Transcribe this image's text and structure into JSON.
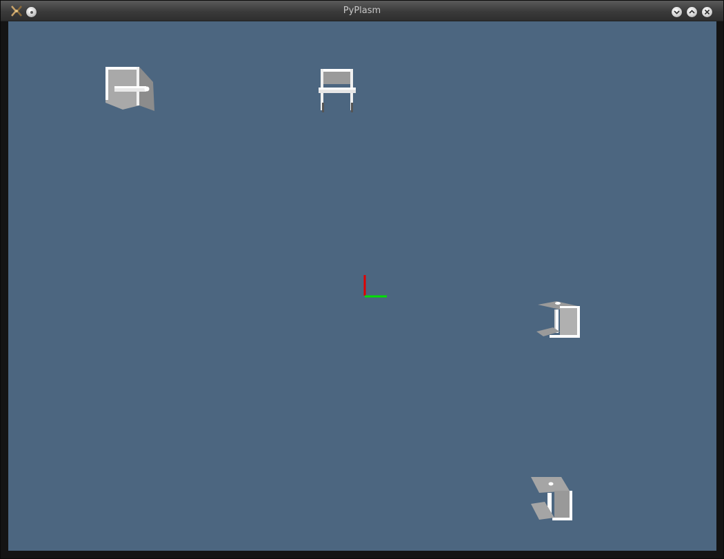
{
  "window": {
    "title": "PyPlasm",
    "icons": {
      "app": "pyplasm-app-icon",
      "pin": "pin-icon",
      "minimize": "minimize-icon",
      "maximize": "maximize-icon",
      "close": "close-icon"
    }
  },
  "viewer": {
    "background_color": "#4c6680",
    "axes": {
      "x_color": "#00e000",
      "y_color": "#e00000"
    },
    "objects": [
      {
        "name": "chair-model-1"
      },
      {
        "name": "chair-model-2"
      },
      {
        "name": "chair-model-3"
      },
      {
        "name": "chair-model-4"
      }
    ]
  }
}
